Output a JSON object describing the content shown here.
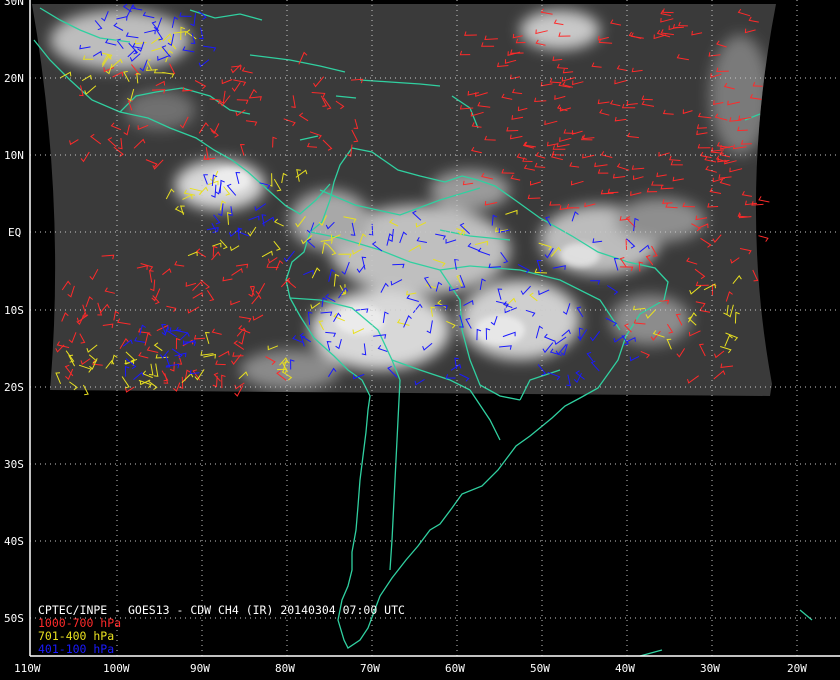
{
  "title": "CPTEC/INPE - GOES13 - CDW CH4 (IR) 20140304 07:00 UTC",
  "legend": [
    {
      "label": "1000-700 hPa",
      "color": "#ff2a2a"
    },
    {
      "label": "701-400 hPa",
      "color": "#e8e020"
    },
    {
      "label": "401-100 hPa",
      "color": "#1a1aff"
    }
  ],
  "coastline_color": "#30d0a0",
  "lat_labels": [
    "30N",
    "20N",
    "10N",
    "EQ",
    "10S",
    "20S",
    "30S",
    "40S",
    "50S"
  ],
  "lon_labels": [
    "110W",
    "100W",
    "90W",
    "80W",
    "70W",
    "60W",
    "50W",
    "40W",
    "30W",
    "20W"
  ]
}
